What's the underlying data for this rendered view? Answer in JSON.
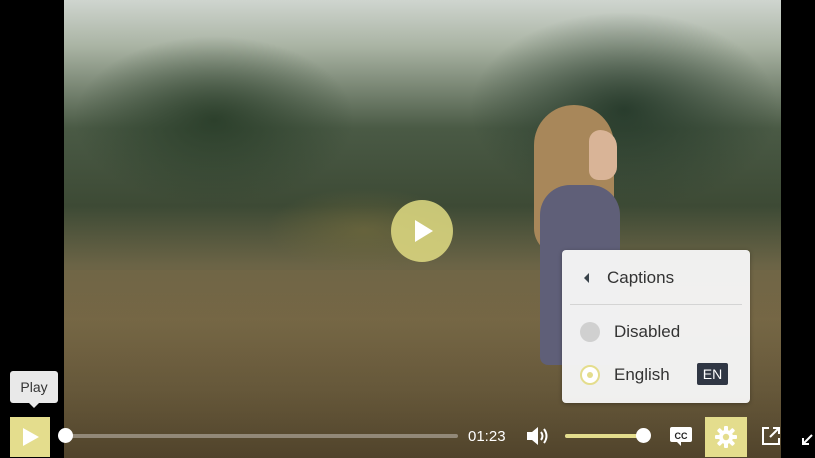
{
  "video": {
    "state": "paused",
    "description_icon": "play-icon"
  },
  "tooltip": {
    "text": "Play"
  },
  "controls": {
    "current_time": "01:23",
    "progress_fraction": 0.0,
    "volume_fraction": 1.0,
    "accent_color": "#e4dd8d"
  },
  "captions_menu": {
    "title": "Captions",
    "options": [
      {
        "label": "Disabled",
        "selected": false
      },
      {
        "label": "English",
        "selected": true,
        "badge": "EN"
      }
    ]
  },
  "icons": [
    "play-icon",
    "volume-icon",
    "closed-captions-icon",
    "gear-icon",
    "popout-icon",
    "exit-fullscreen-icon",
    "chevron-left-icon"
  ]
}
